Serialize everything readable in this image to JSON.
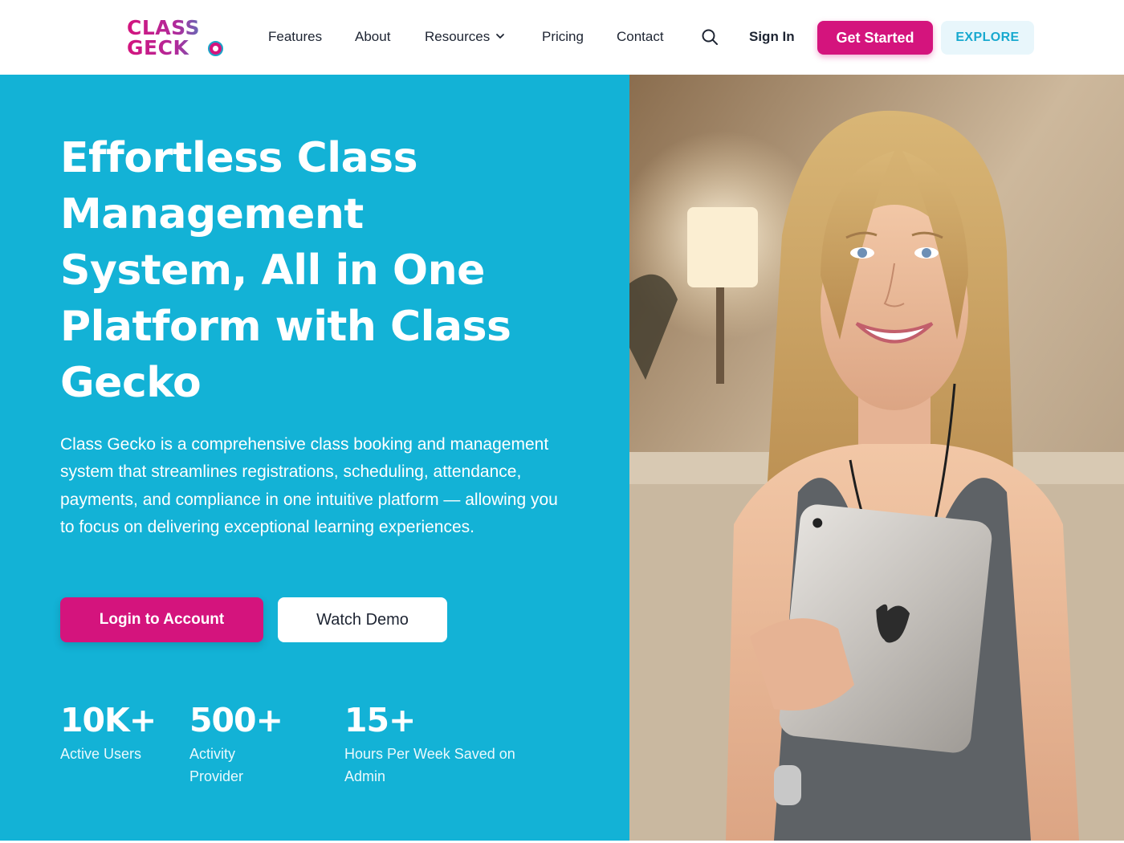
{
  "brand": {
    "logo_line1": "CLASS",
    "logo_line2": "GECK",
    "primary_color": "#d4147d",
    "accent_color": "#13b2d6"
  },
  "nav": {
    "items": [
      {
        "label": "Features"
      },
      {
        "label": "About"
      },
      {
        "label": "Resources"
      },
      {
        "label": "Pricing"
      },
      {
        "label": "Contact"
      }
    ],
    "search_icon": "search-icon",
    "sign_in": "Sign In",
    "get_started": "Get Started",
    "explore": "EXPLORE"
  },
  "hero": {
    "title": "Effortless Class Management System, All in One Platform with Class Gecko",
    "description": "Class Gecko is a comprehensive class booking and management system that streamlines registrations, scheduling, attendance, payments, and compliance in one intuitive platform — allowing you to focus on delivering exceptional learning experiences.",
    "login_button": "Login to Account",
    "demo_button": "Watch Demo",
    "stats": [
      {
        "value": "10K+",
        "label": "Active Users"
      },
      {
        "value": "500+",
        "label": "Activity Provider"
      },
      {
        "value": "15+",
        "label": "Hours Per Week Saved on Admin"
      }
    ],
    "image": "smiling-instructor-with-tablet"
  }
}
